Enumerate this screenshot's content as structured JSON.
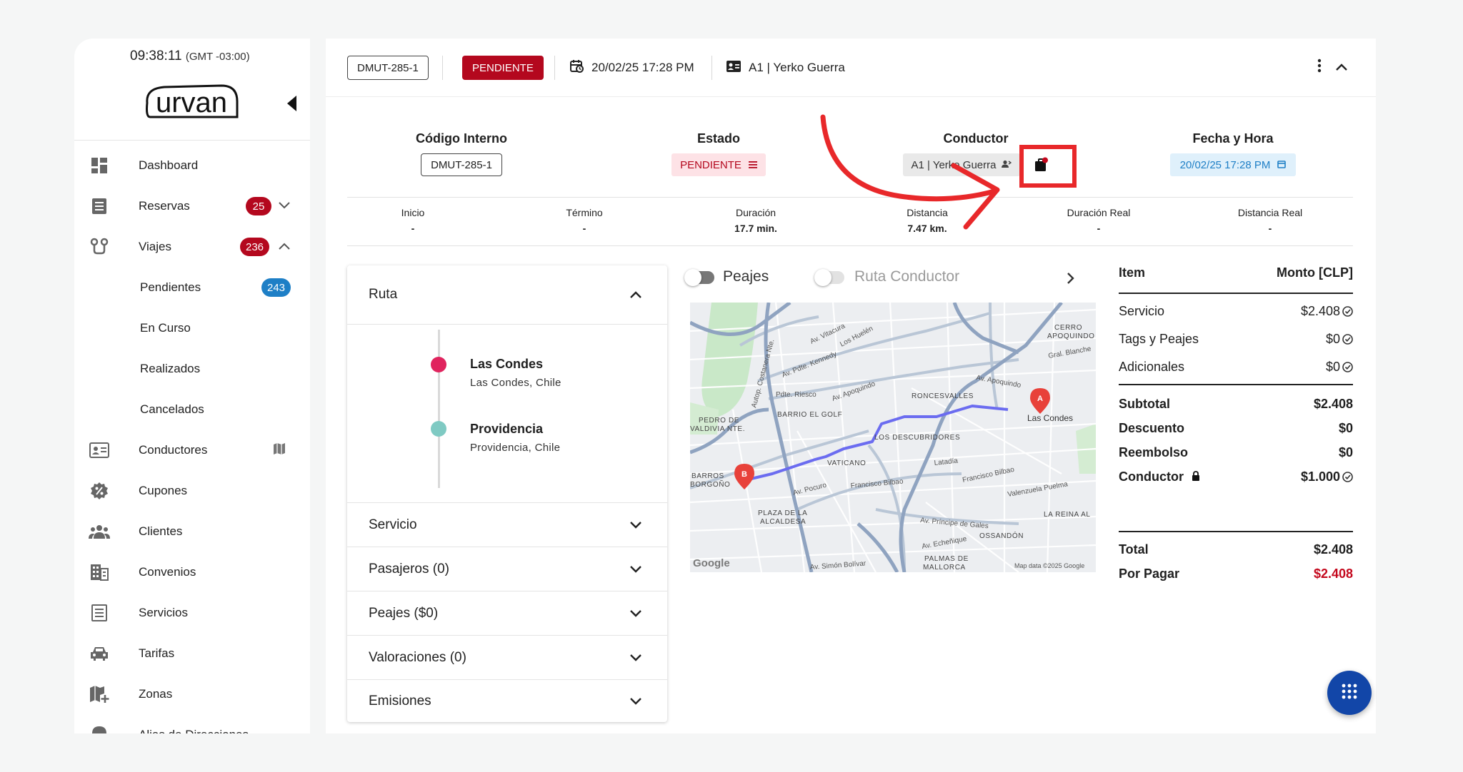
{
  "clock": {
    "time": "09:38:11",
    "tz": "(GMT -03:00)"
  },
  "brand": "urvan",
  "nav": [
    {
      "label": "Dashboard"
    },
    {
      "label": "Reservas",
      "badge": "25"
    },
    {
      "label": "Viajes",
      "badge": "236"
    },
    {
      "label": "Pendientes",
      "badge": "243"
    },
    {
      "label": "En Curso"
    },
    {
      "label": "Realizados"
    },
    {
      "label": "Cancelados"
    },
    {
      "label": "Conductores"
    },
    {
      "label": "Cupones"
    },
    {
      "label": "Clientes"
    },
    {
      "label": "Convenios"
    },
    {
      "label": "Servicios"
    },
    {
      "label": "Tarifas"
    },
    {
      "label": "Zonas"
    },
    {
      "label": "Alias de Direcciones"
    }
  ],
  "topbar": {
    "code": "DMUT-285-1",
    "status": "PENDIENTE",
    "datetime": "20/02/25 17:28 PM",
    "driver": "A1 | Yerko Guerra"
  },
  "info": {
    "codigo_title": "Código Interno",
    "codigo_value": "DMUT-285-1",
    "estado_title": "Estado",
    "estado_value": "PENDIENTE",
    "conductor_title": "Conductor",
    "conductor_value": "A1 | Yerko Guerra",
    "fecha_title": "Fecha y Hora",
    "fecha_value": "20/02/25 17:28 PM"
  },
  "stats": [
    {
      "label": "Inicio",
      "value": "-"
    },
    {
      "label": "Término",
      "value": "-"
    },
    {
      "label": "Duración",
      "value": "17.7 min."
    },
    {
      "label": "Distancia",
      "value": "7.47 km."
    },
    {
      "label": "Duración Real",
      "value": "-"
    },
    {
      "label": "Distancia Real",
      "value": "-"
    }
  ],
  "accordion": {
    "ruta": "Ruta",
    "stops": [
      {
        "name": "Las Condes",
        "sub": "Las Condes, Chile",
        "color": "#e0245e"
      },
      {
        "name": "Providencia",
        "sub": "Providencia, Chile",
        "color": "#7fcac3"
      }
    ],
    "sections": [
      "Servicio",
      "Pasajeros (0)",
      "Peajes ($0)",
      "Valoraciones (0)",
      "Emisiones"
    ]
  },
  "map": {
    "toggle_peajes": "Peajes",
    "toggle_ruta": "Ruta Conductor",
    "labels": {
      "vitacura": "Av. Vitacura",
      "huelen": "Los Huelén",
      "kennedy": "Av. Pdte. Kennedy",
      "costanera": "Autop. Costanera Nte.",
      "riesco": "Pdte. Riesco",
      "apoquindo": "Av. Apoquindo",
      "barrio_golf": "BARRIO EL GOLF",
      "roncesvalles": "RONCESVALLES",
      "pedro": "PEDRO DE",
      "valdivia": "VALDIVIA NTE.",
      "descubridores": "LOS DESCUBRIDORES",
      "vaticano": "VATICANO",
      "latadia": "Latadía",
      "barros": "BARROS",
      "borgono": "BORGOÑO",
      "pocuro": "Av. Pocuro",
      "bilbao": "Francisco Bilbao",
      "bilbao2": "Francisco Bilbao",
      "plaza": "PLAZA DE LA",
      "alcaldesa": "ALCALDESA",
      "principe": "Av. Príncipe de Gales",
      "reina": "LA REINA AL",
      "echenique": "Av. Echeñique",
      "ossandon": "OSSANDÓN",
      "palmas": "PALMAS DE",
      "mallorca": "MALLORCA",
      "simon": "Av. Simón Bolívar",
      "cerro": "CERRO",
      "apoq_up": "APOQUINDO",
      "blanche": "Gral. Blanche",
      "lascondes": "Las Condes",
      "valenzuela": "Valenzuela Puelma",
      "copyright": "Map data ©2025 Google",
      "google": "Google"
    }
  },
  "pricing": {
    "item_header": "Item",
    "monto_header": "Monto [CLP]",
    "rows": [
      {
        "k": "Servicio",
        "v": "$2.408"
      },
      {
        "k": "Tags y Peajes",
        "v": "$0"
      },
      {
        "k": "Adicionales",
        "v": "$0"
      }
    ],
    "subtotal": {
      "k": "Subtotal",
      "v": "$2.408"
    },
    "descuento": {
      "k": "Descuento",
      "v": "$0"
    },
    "reembolso": {
      "k": "Reembolso",
      "v": "$0"
    },
    "conductor": {
      "k": "Conductor",
      "v": "$1.000"
    },
    "total": {
      "k": "Total",
      "v": "$2.408"
    },
    "porpagar": {
      "k": "Por Pagar",
      "v": "$2.408"
    }
  },
  "colors": {
    "brand_red": "#b4081e",
    "accent_blue": "#1e7fc6",
    "fab": "#1246a8",
    "annotation": "#e8282a"
  }
}
